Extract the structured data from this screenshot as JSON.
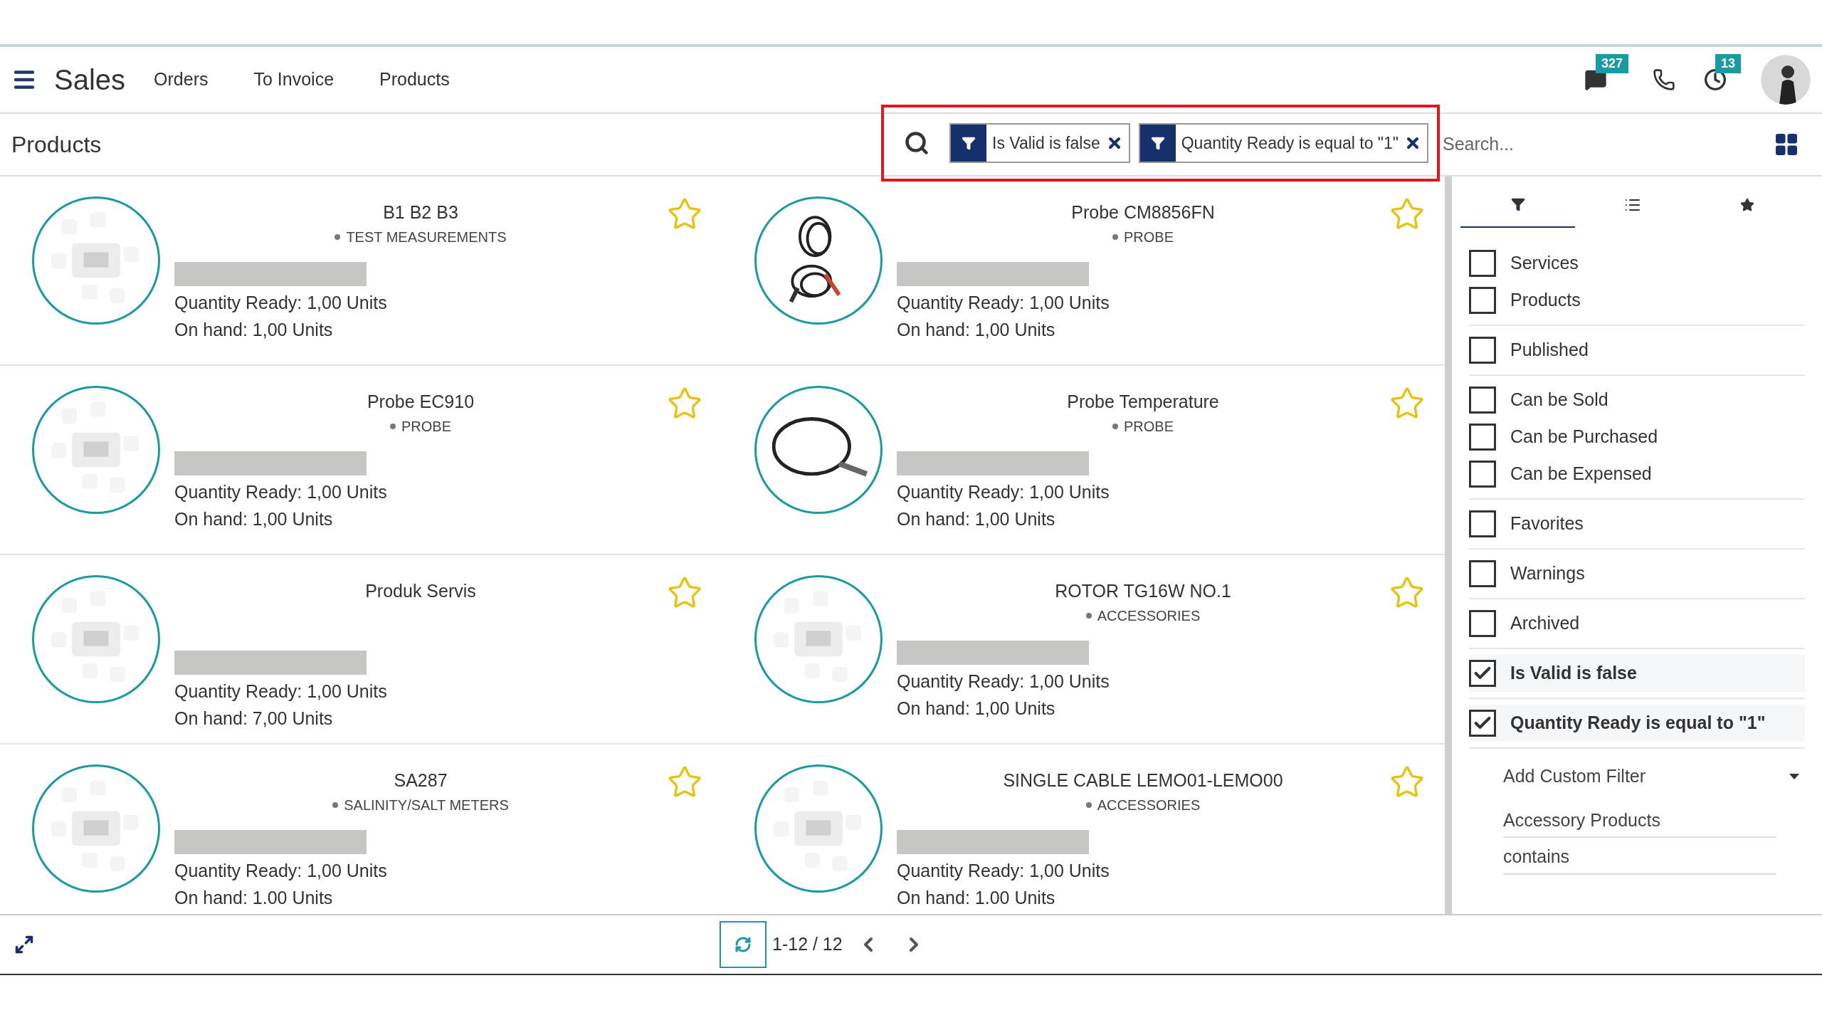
{
  "navbar": {
    "app": "Sales",
    "menu": [
      "Orders",
      "To Invoice",
      "Products"
    ],
    "messages_count": "327",
    "activities_count": "13"
  },
  "control_panel": {
    "title": "Products",
    "facets": [
      "Is Valid is false",
      "Quantity Ready is equal to \"1\""
    ],
    "search": {
      "placeholder": "Search..."
    }
  },
  "products": [
    {
      "name": "B1 B2 B3",
      "category": "TEST MEASUREMENTS",
      "quantity_ready": "Quantity Ready: 1,00 Units",
      "on_hand": "On hand: 1,00 Units",
      "favorite": false
    },
    {
      "name": "Probe CM8856FN",
      "category": "PROBE",
      "quantity_ready": "Quantity Ready: 1,00 Units",
      "on_hand": "On hand: 1,00 Units",
      "favorite": false
    },
    {
      "name": "Probe EC910",
      "category": "PROBE",
      "quantity_ready": "Quantity Ready: 1,00 Units",
      "on_hand": "On hand: 1,00 Units",
      "favorite": false
    },
    {
      "name": "Probe Temperature",
      "category": "PROBE",
      "quantity_ready": "Quantity Ready: 1,00 Units",
      "on_hand": "On hand: 1,00 Units",
      "favorite": false
    },
    {
      "name": "Produk Servis",
      "quantity_ready": "Quantity Ready: 1,00 Units",
      "on_hand": "On hand: 7,00 Units",
      "favorite": false
    },
    {
      "name": "ROTOR TG16W NO.1",
      "category": "ACCESSORIES",
      "quantity_ready": "Quantity Ready: 1,00 Units",
      "on_hand": "On hand: 1,00 Units",
      "favorite": false
    },
    {
      "name": "SA287",
      "category": "SALINITY/SALT METERS",
      "quantity_ready": "Quantity Ready: 1,00 Units",
      "on_hand": "On hand: 1.00 Units",
      "favorite": false
    },
    {
      "name": "SINGLE CABLE LEMO01-LEMO00",
      "category": "ACCESSORIES",
      "quantity_ready": "Quantity Ready: 1,00 Units",
      "on_hand": "On hand: 1.00 Units",
      "favorite": false
    }
  ],
  "filter_panel": {
    "tabs": [
      {
        "kind": "filter",
        "selected": true
      },
      {
        "kind": "group",
        "selected": false
      },
      {
        "kind": "favorites",
        "selected": false
      }
    ],
    "groups": [
      [
        {
          "label": "Services",
          "checked": false
        },
        {
          "label": "Products",
          "checked": false
        }
      ],
      [
        {
          "label": "Published",
          "checked": false
        }
      ],
      [
        {
          "label": "Can be Sold",
          "checked": false
        },
        {
          "label": "Can be Purchased",
          "checked": false
        },
        {
          "label": "Can be Expensed",
          "checked": false
        }
      ],
      [
        {
          "label": "Favorites",
          "checked": false
        }
      ],
      [
        {
          "label": "Warnings",
          "checked": false
        }
      ],
      [
        {
          "label": "Archived",
          "checked": false
        }
      ],
      [
        {
          "label": "Is Valid is false",
          "checked": true
        }
      ],
      [
        {
          "label": "Quantity Ready is equal to \"1\"",
          "checked": true
        }
      ]
    ],
    "custom_filter": {
      "label": "Add Custom Filter",
      "field": "Accessory Products",
      "operator": "contains"
    }
  },
  "pager": {
    "range": "1-12 / 12"
  }
}
